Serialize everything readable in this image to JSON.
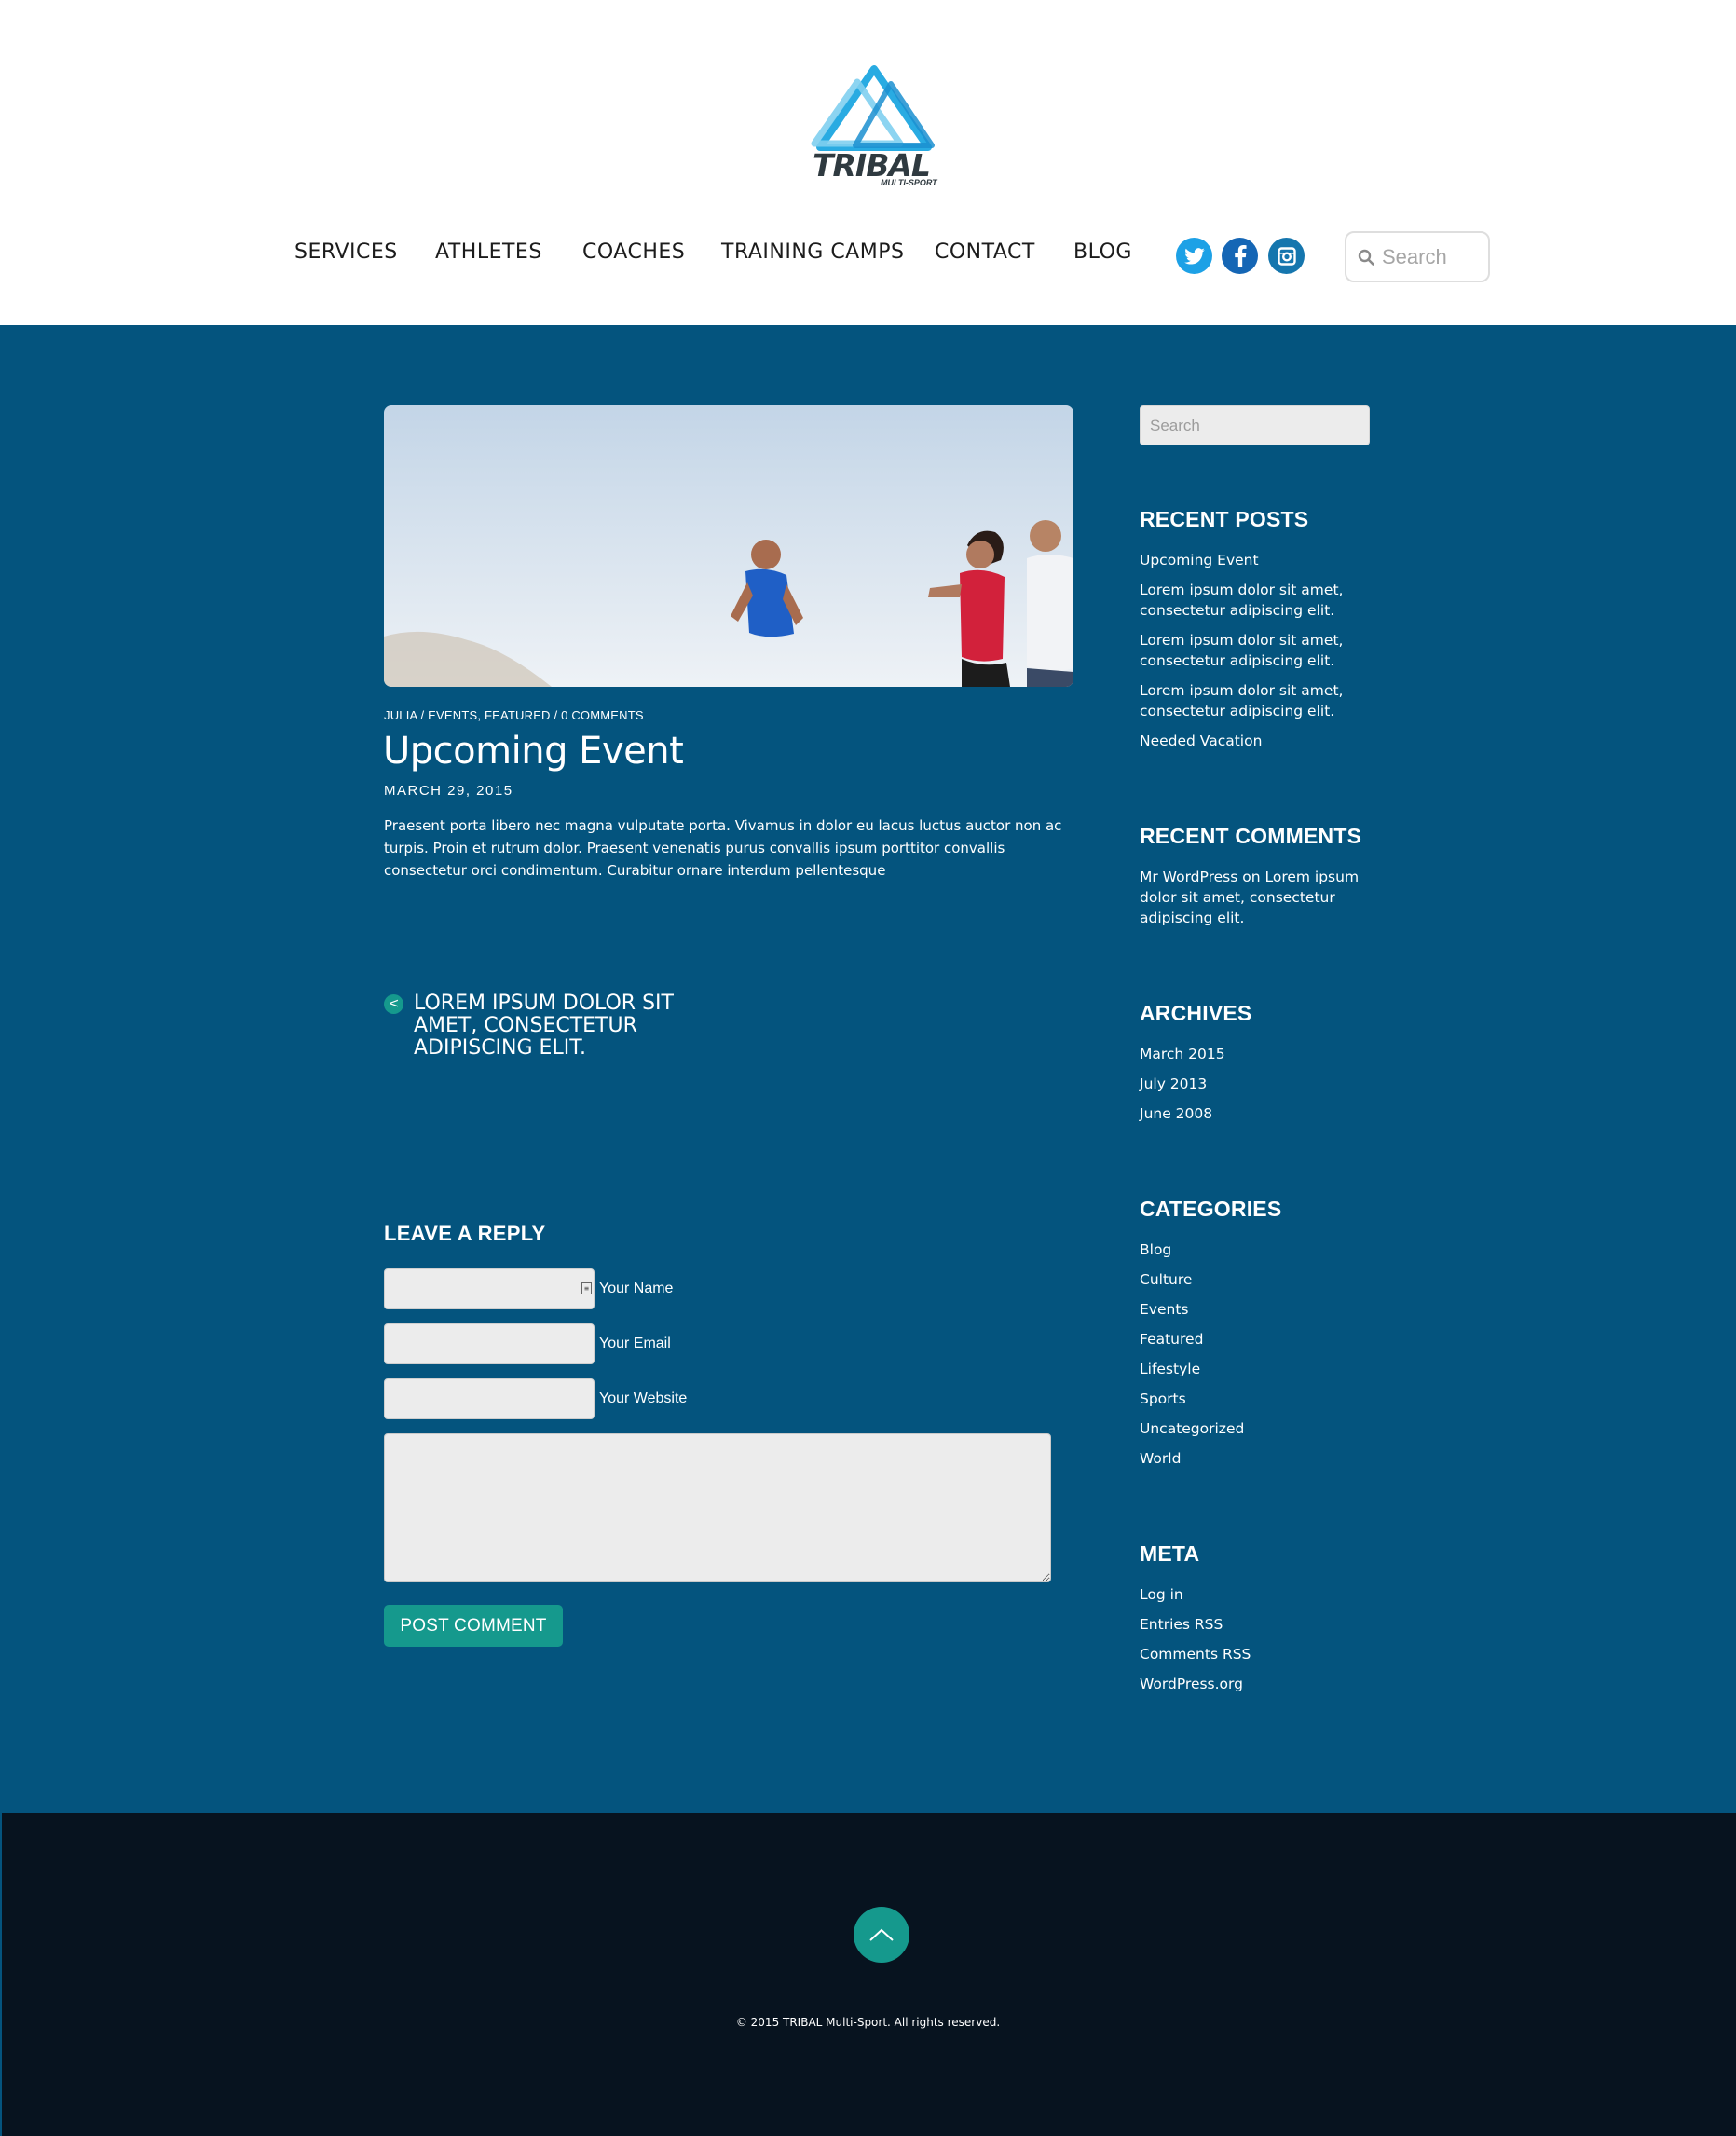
{
  "header": {
    "logo_text": "TRIBAL",
    "logo_subtext": "MULTI-SPORT",
    "nav": [
      "SERVICES",
      "ATHLETES",
      "COACHES",
      "TRAINING CAMPS",
      "CONTACT",
      "BLOG"
    ],
    "social": [
      "twitter-icon",
      "facebook-icon",
      "instagram-icon"
    ],
    "search_placeholder": "Search"
  },
  "post": {
    "meta": "JULIA / EVENTS, FEATURED / 0 COMMENTS",
    "title": "Upcoming Event",
    "date": "MARCH 29, 2015",
    "body": "Praesent porta libero nec magna vulputate porta. Vivamus in dolor eu lacus luctus auctor non ac turpis. Proin et rutrum dolor. Praesent venenatis purus convallis ipsum porttitor convallis consectetur orci condimentum. Curabitur ornare interdum pellentesque",
    "prev_arrow": "<",
    "prev_title": "LOREM IPSUM DOLOR SIT AMET, CONSECTETUR ADIPISCING ELIT."
  },
  "reply": {
    "title": "LEAVE A REPLY",
    "name_label": "Your Name",
    "email_label": "Your Email",
    "website_label": "Your Website",
    "submit_label": "POST COMMENT"
  },
  "sidebar": {
    "search_placeholder": "Search",
    "recent_posts_title": "RECENT POSTS",
    "recent_posts": [
      "Upcoming Event",
      "Lorem ipsum dolor sit amet, consectetur adipiscing elit.",
      "Lorem ipsum dolor sit amet, consectetur adipiscing elit.",
      "Lorem ipsum dolor sit amet, consectetur adipiscing elit.",
      "Needed Vacation"
    ],
    "recent_comments_title": "RECENT COMMENTS",
    "recent_comment": "Mr WordPress on Lorem ipsum dolor sit amet, consectetur adipiscing elit.",
    "archives_title": "ARCHIVES",
    "archives": [
      "March 2015",
      "July 2013",
      "June 2008"
    ],
    "categories_title": "CATEGORIES",
    "categories": [
      "Blog",
      "Culture",
      "Events",
      "Featured",
      "Lifestyle",
      "Sports",
      "Uncategorized",
      "World"
    ],
    "meta_title": "META",
    "meta": [
      "Log in",
      "Entries RSS",
      "Comments RSS",
      "WordPress.org"
    ]
  },
  "footer": {
    "copyright": "© 2015 TRIBAL Multi-Sport. All rights reserved."
  },
  "colors": {
    "main_bg": "#04547e",
    "footer_bg": "#07131f",
    "accent": "#15998d",
    "logo_blue": "#29abe2"
  }
}
